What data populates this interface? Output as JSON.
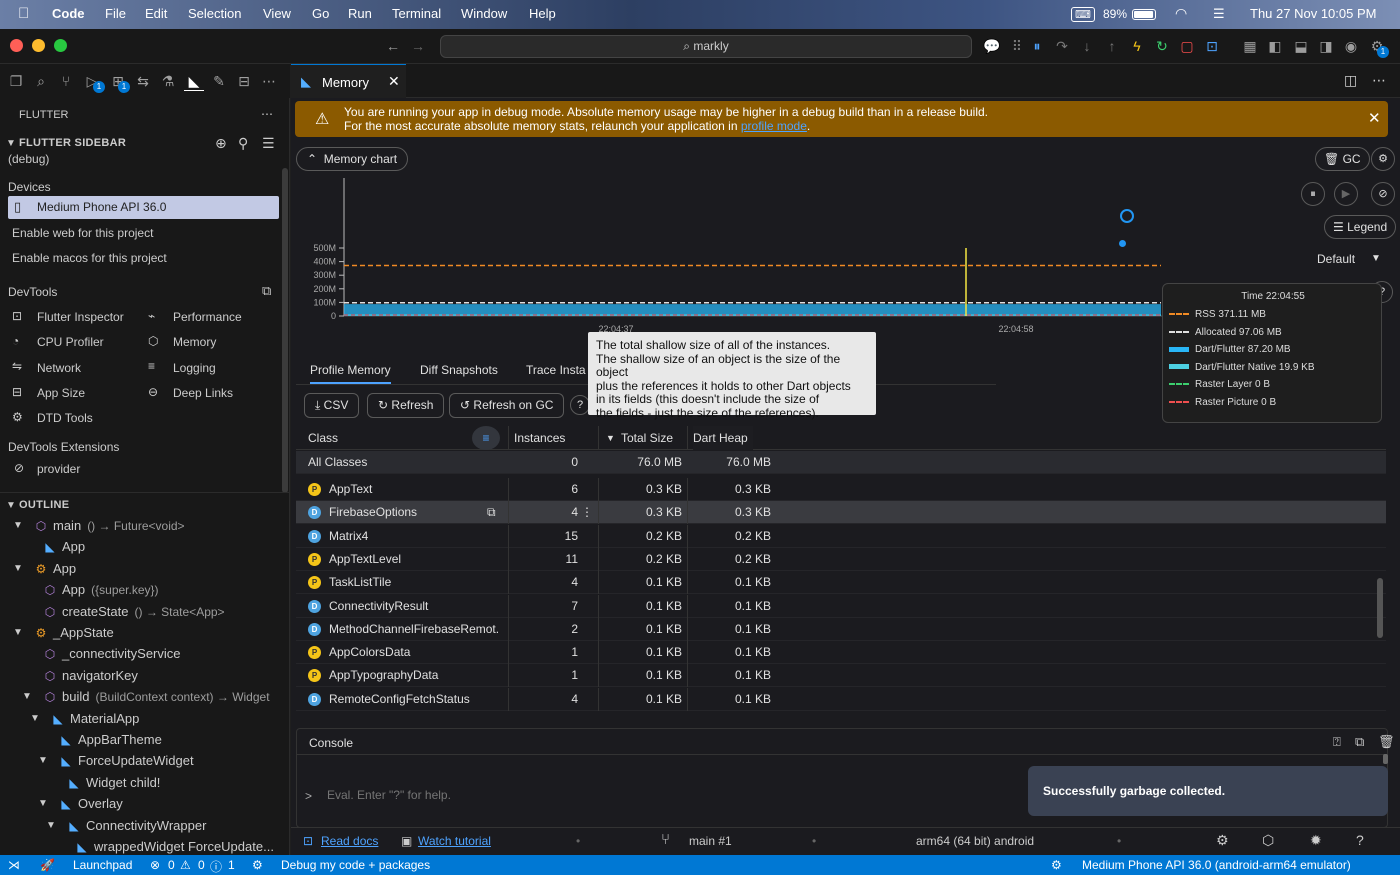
{
  "menubar": {
    "app": "Code",
    "items": [
      "File",
      "Edit",
      "Selection",
      "View",
      "Go",
      "Run",
      "Terminal",
      "Window",
      "Help"
    ],
    "battery": "89%",
    "datetime": "Thu 27 Nov  10:05 PM"
  },
  "titlebar": {
    "search": "markly"
  },
  "activity_badges": [
    "1",
    "1"
  ],
  "sidebar": {
    "header": "FLUTTER",
    "flutter_sidebar_title": "FLUTTER SIDEBAR",
    "flutter_sidebar_mode": "(debug)",
    "devices_label": "Devices",
    "device_selected": "Medium Phone API 36.0",
    "enable_web": "Enable web for this project",
    "enable_macos": "Enable macos for this project",
    "devtools_label": "DevTools",
    "devtools_left": [
      "Flutter Inspector",
      "CPU Profiler",
      "Network",
      "App Size",
      "DTD Tools"
    ],
    "devtools_right": [
      "Performance",
      "Memory",
      "Logging",
      "Deep Links"
    ],
    "extensions_label": "DevTools Extensions",
    "extension_item": "provider",
    "outline_label": "OUTLINE",
    "outline": [
      {
        "label": "main",
        "detail": "() → Future<void>"
      },
      {
        "label": "App",
        "detail": ""
      },
      {
        "label": "App",
        "detail": ""
      },
      {
        "label": "App",
        "detail": "({super.key})"
      },
      {
        "label": "createState",
        "detail": "() → State<App>"
      },
      {
        "label": "_AppState",
        "detail": ""
      },
      {
        "label": "_connectivityService",
        "detail": ""
      },
      {
        "label": "navigatorKey",
        "detail": ""
      },
      {
        "label": "build",
        "detail": "(BuildContext context) → Widget"
      },
      {
        "label": "MaterialApp",
        "detail": ""
      },
      {
        "label": "AppBarTheme",
        "detail": ""
      },
      {
        "label": "ForceUpdateWidget",
        "detail": ""
      },
      {
        "label": "Widget child!",
        "detail": ""
      },
      {
        "label": "Overlay",
        "detail": ""
      },
      {
        "label": "ConnectivityWrapper",
        "detail": ""
      },
      {
        "label": "wrappedWidget ForceUpdate...",
        "detail": ""
      }
    ]
  },
  "editor": {
    "tab": "Memory"
  },
  "banner": {
    "line1": "You are running your app in debug mode. Absolute memory usage may be higher in a debug build than in a release build.",
    "line2_prefix": "For the most accurate absolute memory stats, relaunch your application in ",
    "line2_link": "profile mode",
    "line2_suffix": "."
  },
  "controls": {
    "memory_chart": "Memory chart",
    "gc": "GC",
    "legend": "Legend",
    "default": "Default"
  },
  "chart_data": {
    "type": "line",
    "y_ticks": [
      "500M",
      "400M",
      "300M",
      "200M",
      "100M",
      "0"
    ],
    "x_ticks": [
      "22:04:37",
      "22:04:58"
    ],
    "series": [
      {
        "name": "RSS",
        "color": "#f08a24",
        "values": [
          371,
          371,
          371,
          371,
          371,
          371,
          371,
          371,
          371,
          371,
          371,
          371
        ]
      },
      {
        "name": "Allocated",
        "color": "#e0e0e0",
        "values": [
          97,
          97,
          97,
          97,
          97,
          97,
          97,
          97,
          97,
          97,
          97,
          97
        ]
      },
      {
        "name": "Dart/Flutter",
        "color": "#29b6f6",
        "values": [
          87,
          87,
          87,
          87,
          87,
          87,
          87,
          87,
          87,
          87,
          87,
          87
        ]
      },
      {
        "name": "Dart/Flutter Native",
        "color": "#4dd0e1",
        "values": [
          0.02,
          0.02,
          0.02,
          0.02,
          0.02,
          0.02,
          0.02,
          0.02,
          0.02,
          0.02,
          0.02,
          0.02
        ]
      }
    ],
    "ylim": [
      0,
      500
    ]
  },
  "legend_box": {
    "time": "Time 22:04:55",
    "rows": [
      {
        "label": "RSS 371.11 MB",
        "color": "#f08a24",
        "style": "dashed"
      },
      {
        "label": "Allocated 97.06 MB",
        "color": "#e0e0e0",
        "style": "dashed"
      },
      {
        "label": "Dart/Flutter 87.20 MB",
        "color": "#29b6f6",
        "style": "solid"
      },
      {
        "label": "Dart/Flutter Native 19.9 KB",
        "color": "#4dd0e1",
        "style": "solid"
      },
      {
        "label": "Raster Layer 0 B",
        "color": "#3ccf6e",
        "style": "dashed"
      },
      {
        "label": "Raster Picture 0 B",
        "color": "#ef4f4f",
        "style": "dashed"
      }
    ]
  },
  "tooltip": {
    "lines": [
      "The total shallow size of all of the instances.",
      "The shallow size of an object is the size of the object",
      "plus the references it holds to other Dart objects",
      "in its fields (this doesn't include the size of",
      "the fields - just the size of the references)."
    ]
  },
  "profile_tabs": [
    "Profile Memory",
    "Diff Snapshots",
    "Trace Insta"
  ],
  "profile_buttons": {
    "csv": "CSV",
    "refresh": "Refresh",
    "refresh_gc": "Refresh on GC"
  },
  "table": {
    "headers": [
      "Class",
      "Instances",
      "Total Size",
      "Dart Heap"
    ],
    "all_classes": {
      "name": "All Classes",
      "instances": "0",
      "total": "76.0 MB",
      "heap": "76.0 MB"
    },
    "rows": [
      {
        "type": "P",
        "name": "AppText",
        "instances": "6",
        "total": "0.3 KB",
        "heap": "0.3 KB"
      },
      {
        "type": "D",
        "name": "FirebaseOptions",
        "instances": "4",
        "total": "0.3 KB",
        "heap": "0.3 KB"
      },
      {
        "type": "D",
        "name": "Matrix4",
        "instances": "15",
        "total": "0.2 KB",
        "heap": "0.2 KB"
      },
      {
        "type": "P",
        "name": "AppTextLevel",
        "instances": "11",
        "total": "0.2 KB",
        "heap": "0.2 KB"
      },
      {
        "type": "P",
        "name": "TaskListTile",
        "instances": "4",
        "total": "0.1 KB",
        "heap": "0.1 KB"
      },
      {
        "type": "D",
        "name": "ConnectivityResult",
        "instances": "7",
        "total": "0.1 KB",
        "heap": "0.1 KB"
      },
      {
        "type": "D",
        "name": "MethodChannelFirebaseRemot...",
        "instances": "2",
        "total": "0.1 KB",
        "heap": "0.1 KB"
      },
      {
        "type": "P",
        "name": "AppColorsData",
        "instances": "1",
        "total": "0.1 KB",
        "heap": "0.1 KB"
      },
      {
        "type": "P",
        "name": "AppTypographyData",
        "instances": "1",
        "total": "0.1 KB",
        "heap": "0.1 KB"
      },
      {
        "type": "D",
        "name": "RemoteConfigFetchStatus",
        "instances": "4",
        "total": "0.1 KB",
        "heap": "0.1 KB"
      }
    ]
  },
  "console": {
    "title": "Console",
    "prompt": ">",
    "placeholder": "Eval. Enter \"?\" for help.",
    "snackbar": "Successfully garbage collected."
  },
  "footer": {
    "read_docs": "Read docs",
    "watch_tutorial": "Watch tutorial",
    "isolate": "main #1",
    "platform": "arm64 (64 bit) android"
  },
  "statusbar": {
    "launchpad": "Launchpad",
    "errors": "0",
    "warnings": "0",
    "info": "0",
    "ports": "1",
    "debug": "Debug my code + packages",
    "device": "Medium Phone API 36.0 (android-arm64 emulator)"
  },
  "colors": {
    "accent": "#0078d4",
    "banner": "#8b5a00",
    "rss": "#f08a24",
    "dart": "#29b6f6"
  }
}
